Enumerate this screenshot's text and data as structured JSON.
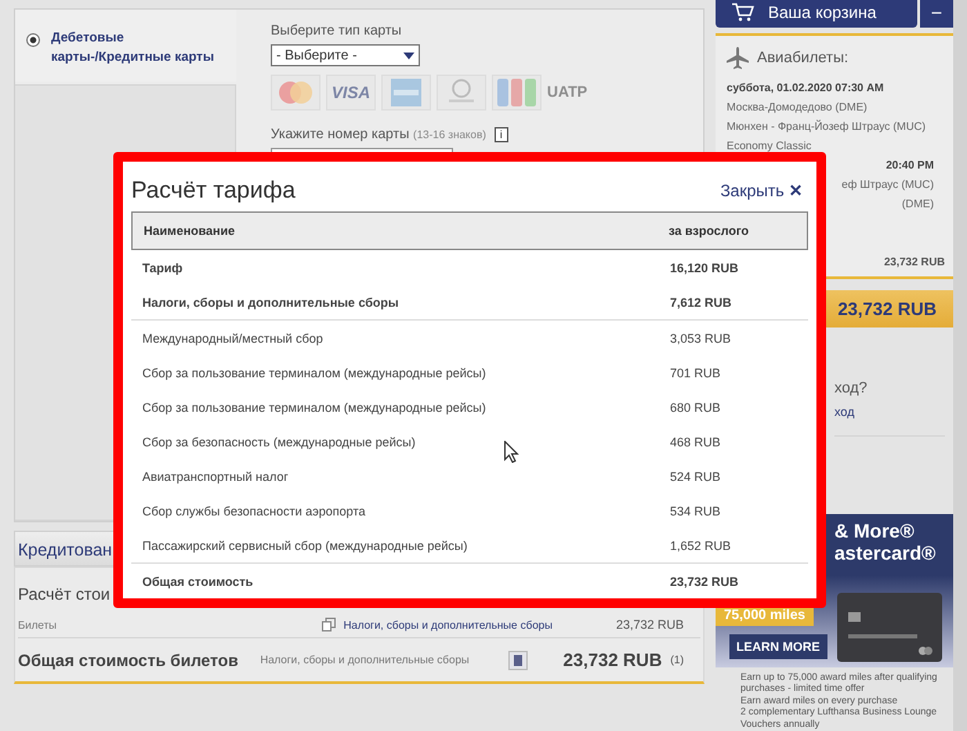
{
  "payment": {
    "method": {
      "label_line1": "Дебетовые",
      "label_line2": "карты-/Кредитные карты",
      "selected": true
    },
    "card_type_label": "Выберите тип карты",
    "card_type_value": "- Выберите -",
    "card_logos": [
      {
        "kind": "mastercard"
      },
      {
        "kind": "visa",
        "label": "VISA"
      },
      {
        "kind": "amex"
      },
      {
        "kind": "diners"
      },
      {
        "kind": "jcb"
      },
      {
        "kind": "uatp",
        "label": "UATP"
      }
    ],
    "card_number_label": "Укажите номер карты",
    "card_number_hint": "(13-16 знаков)",
    "info": "i"
  },
  "credit_tab": "Кредитован",
  "price_section": {
    "title": "Расчёт стои",
    "tickets_label": "Билеты",
    "taxes_link": "Налоги, сборы и дополнительные сборы",
    "tickets_amount": "23,732 RUB",
    "total_label": "Общая стоимость билетов",
    "total_taxes": "Налоги, сборы и дополнительные сборы",
    "total_amount": "23,732 RUB",
    "footnote": "(1)"
  },
  "cart": {
    "button": "Ваша корзина",
    "collapse": "−",
    "section_title": "Авиабилеты:",
    "outbound": {
      "date": "суббота, 01.02.2020 07:30 AM",
      "from": "Москва-Домодедово (DME)",
      "to": "Мюнхен - Франц-Йозеф Штраус (MUC)",
      "cabin": "Economy Classic"
    },
    "return": {
      "time": "20:40 PM",
      "from": "еф Штраус (MUC)",
      "to": "(DME)"
    },
    "subtotal": "23,732 RUB",
    "total": "23,732 RUB",
    "promo_question": "ход?",
    "promo_link": "ход"
  },
  "ad": {
    "title_line1": "& More®",
    "title_line2": "astercard®",
    "miles_tag": "75,000 miles",
    "button": "LEARN MORE",
    "bullets": [
      "Earn up to 75,000 award miles after qualifying purchases - limited time offer",
      "Earn award miles on every purchase",
      "2 complementary Lufthansa Business Lounge Vouchers annually"
    ]
  },
  "modal": {
    "title": "Расчёт тарифа",
    "close": "Закрыть",
    "close_icon": "✕",
    "columns": [
      "Наименование",
      "за взрослого"
    ],
    "rows": [
      {
        "kind": "summary",
        "name": "Тариф",
        "amount": "16,120 RUB"
      },
      {
        "kind": "summary",
        "name": "Налоги, сборы и дополнительные сборы",
        "amount": "7,612 RUB"
      },
      {
        "kind": "detail",
        "name": "Международный/местный сбор",
        "amount": "3,053 RUB"
      },
      {
        "kind": "detail",
        "name": "Сбор за пользование терминалом (международные рейсы)",
        "amount": "701 RUB"
      },
      {
        "kind": "detail",
        "name": "Сбор за пользование терминалом (международные рейсы)",
        "amount": "680 RUB"
      },
      {
        "kind": "detail",
        "name": "Сбор за безопасность (международные рейсы)",
        "amount": "468 RUB"
      },
      {
        "kind": "detail",
        "name": "Авиатранспортный налог",
        "amount": "524 RUB"
      },
      {
        "kind": "detail",
        "name": "Сбор службы безопасности аэропорта",
        "amount": "534 RUB"
      },
      {
        "kind": "detail",
        "name": "Пассажирский сервисный сбор (международные рейсы)",
        "amount": "1,652 RUB"
      },
      {
        "kind": "total",
        "name": "Общая стоимость",
        "amount": "23,732 RUB"
      }
    ]
  }
}
